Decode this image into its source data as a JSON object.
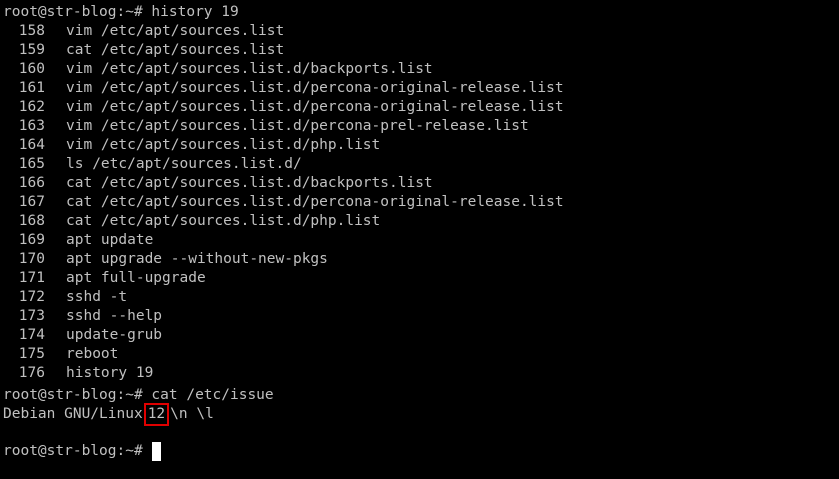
{
  "terminal": {
    "prompt": "root@str-blog:~#",
    "command_1": "history 19",
    "history": [
      {
        "num": "158",
        "cmd": "vim /etc/apt/sources.list"
      },
      {
        "num": "159",
        "cmd": "cat /etc/apt/sources.list"
      },
      {
        "num": "160",
        "cmd": "vim /etc/apt/sources.list.d/backports.list"
      },
      {
        "num": "161",
        "cmd": "vim /etc/apt/sources.list.d/percona-original-release.list"
      },
      {
        "num": "162",
        "cmd": "vim /etc/apt/sources.list.d/percona-original-release.list"
      },
      {
        "num": "163",
        "cmd": "vim /etc/apt/sources.list.d/percona-prel-release.list"
      },
      {
        "num": "164",
        "cmd": "vim /etc/apt/sources.list.d/php.list"
      },
      {
        "num": "165",
        "cmd": "ls /etc/apt/sources.list.d/"
      },
      {
        "num": "166",
        "cmd": "cat /etc/apt/sources.list.d/backports.list"
      },
      {
        "num": "167",
        "cmd": "cat /etc/apt/sources.list.d/percona-original-release.list"
      },
      {
        "num": "168",
        "cmd": "cat /etc/apt/sources.list.d/php.list"
      },
      {
        "num": "169",
        "cmd": "apt update"
      },
      {
        "num": "170",
        "cmd": "apt upgrade --without-new-pkgs"
      },
      {
        "num": "171",
        "cmd": "apt full-upgrade"
      },
      {
        "num": "172",
        "cmd": "sshd -t"
      },
      {
        "num": "173",
        "cmd": "sshd --help"
      },
      {
        "num": "174",
        "cmd": "update-grub"
      },
      {
        "num": "175",
        "cmd": "reboot"
      },
      {
        "num": "176",
        "cmd": "history 19"
      }
    ],
    "command_2": "cat /etc/issue",
    "issue_prefix": "Debian GNU/Linux",
    "issue_version": "12",
    "issue_suffix": "\\n \\l",
    "highlight_color": "#e00000",
    "text_color": "#c0c0c0",
    "background_color": "#000000"
  }
}
